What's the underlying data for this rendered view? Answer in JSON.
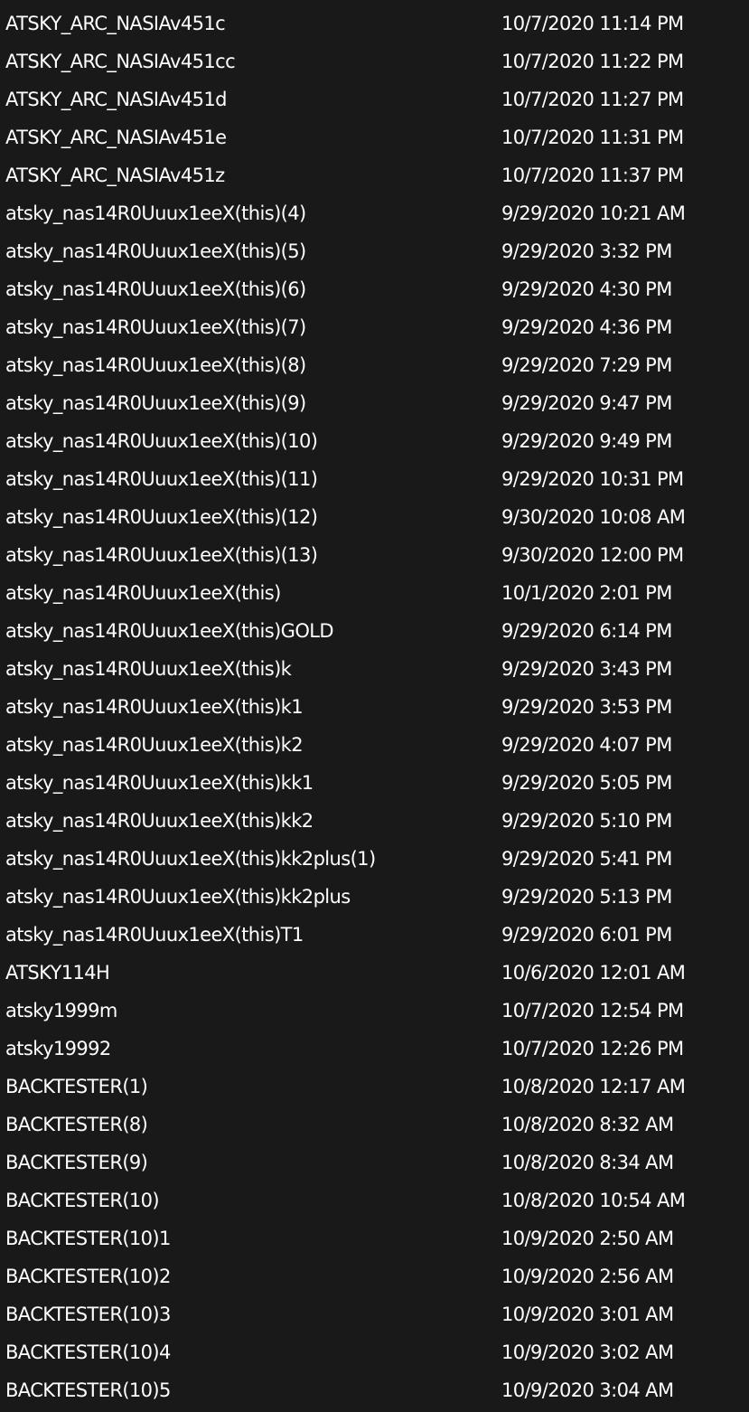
{
  "files": [
    {
      "name": "ATSKY_ARC_NASIAv451c",
      "modified": "10/7/2020 11:14 PM"
    },
    {
      "name": "ATSKY_ARC_NASIAv451cc",
      "modified": "10/7/2020 11:22 PM"
    },
    {
      "name": "ATSKY_ARC_NASIAv451d",
      "modified": "10/7/2020 11:27 PM"
    },
    {
      "name": "ATSKY_ARC_NASIAv451e",
      "modified": "10/7/2020 11:31 PM"
    },
    {
      "name": "ATSKY_ARC_NASIAv451z",
      "modified": "10/7/2020 11:37 PM"
    },
    {
      "name": "atsky_nas14R0Uuux1eeX(this)(4)",
      "modified": "9/29/2020 10:21 AM"
    },
    {
      "name": "atsky_nas14R0Uuux1eeX(this)(5)",
      "modified": "9/29/2020 3:32 PM"
    },
    {
      "name": "atsky_nas14R0Uuux1eeX(this)(6)",
      "modified": "9/29/2020 4:30 PM"
    },
    {
      "name": "atsky_nas14R0Uuux1eeX(this)(7)",
      "modified": "9/29/2020 4:36 PM"
    },
    {
      "name": "atsky_nas14R0Uuux1eeX(this)(8)",
      "modified": "9/29/2020 7:29 PM"
    },
    {
      "name": "atsky_nas14R0Uuux1eeX(this)(9)",
      "modified": "9/29/2020 9:47 PM"
    },
    {
      "name": "atsky_nas14R0Uuux1eeX(this)(10)",
      "modified": "9/29/2020 9:49 PM"
    },
    {
      "name": "atsky_nas14R0Uuux1eeX(this)(11)",
      "modified": "9/29/2020 10:31 PM"
    },
    {
      "name": "atsky_nas14R0Uuux1eeX(this)(12)",
      "modified": "9/30/2020 10:08 AM"
    },
    {
      "name": "atsky_nas14R0Uuux1eeX(this)(13)",
      "modified": "9/30/2020 12:00 PM"
    },
    {
      "name": "atsky_nas14R0Uuux1eeX(this)",
      "modified": "10/1/2020 2:01 PM"
    },
    {
      "name": "atsky_nas14R0Uuux1eeX(this)GOLD",
      "modified": "9/29/2020 6:14 PM"
    },
    {
      "name": "atsky_nas14R0Uuux1eeX(this)k",
      "modified": "9/29/2020 3:43 PM"
    },
    {
      "name": "atsky_nas14R0Uuux1eeX(this)k1",
      "modified": "9/29/2020 3:53 PM"
    },
    {
      "name": "atsky_nas14R0Uuux1eeX(this)k2",
      "modified": "9/29/2020 4:07 PM"
    },
    {
      "name": "atsky_nas14R0Uuux1eeX(this)kk1",
      "modified": "9/29/2020 5:05 PM"
    },
    {
      "name": "atsky_nas14R0Uuux1eeX(this)kk2",
      "modified": "9/29/2020 5:10 PM"
    },
    {
      "name": "atsky_nas14R0Uuux1eeX(this)kk2plus(1)",
      "modified": "9/29/2020 5:41 PM"
    },
    {
      "name": "atsky_nas14R0Uuux1eeX(this)kk2plus",
      "modified": "9/29/2020 5:13 PM"
    },
    {
      "name": "atsky_nas14R0Uuux1eeX(this)T1",
      "modified": "9/29/2020 6:01 PM"
    },
    {
      "name": "ATSKY114H",
      "modified": "10/6/2020 12:01 AM"
    },
    {
      "name": "atsky1999m",
      "modified": "10/7/2020 12:54 PM"
    },
    {
      "name": "atsky19992",
      "modified": "10/7/2020 12:26 PM"
    },
    {
      "name": "BACKTESTER(1)",
      "modified": "10/8/2020 12:17 AM"
    },
    {
      "name": "BACKTESTER(8)",
      "modified": "10/8/2020 8:32 AM"
    },
    {
      "name": "BACKTESTER(9)",
      "modified": "10/8/2020 8:34 AM"
    },
    {
      "name": "BACKTESTER(10)",
      "modified": "10/8/2020 10:54 AM"
    },
    {
      "name": "BACKTESTER(10)1",
      "modified": "10/9/2020 2:50 AM"
    },
    {
      "name": "BACKTESTER(10)2",
      "modified": "10/9/2020 2:56 AM"
    },
    {
      "name": "BACKTESTER(10)3",
      "modified": "10/9/2020 3:01 AM"
    },
    {
      "name": "BACKTESTER(10)4",
      "modified": "10/9/2020 3:02 AM"
    },
    {
      "name": "BACKTESTER(10)5",
      "modified": "10/9/2020 3:04 AM"
    }
  ],
  "colors": {
    "background": "#191919",
    "text": "#ffffff"
  }
}
